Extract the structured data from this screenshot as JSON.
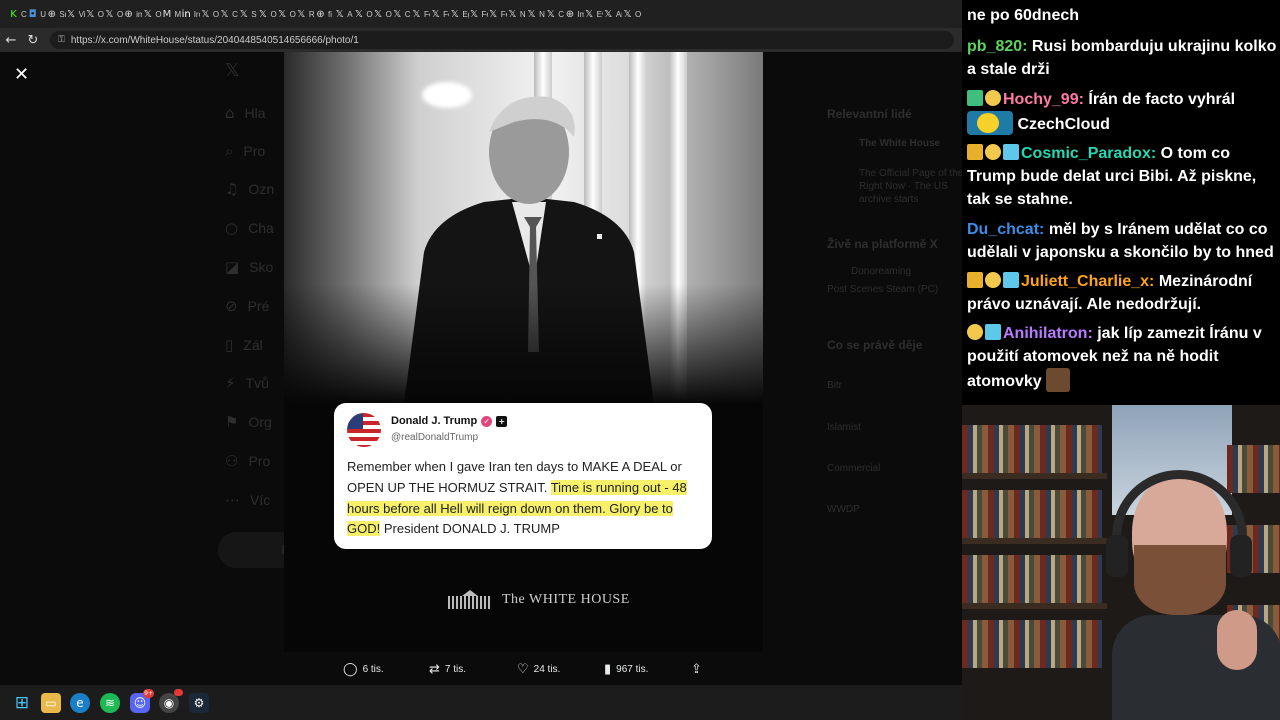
{
  "browser": {
    "tabs": [
      {
        "icon": "K",
        "title": "Cz",
        "color": "#53fc18"
      },
      {
        "icon": "◘",
        "title": "Us",
        "color": "#4a90d9"
      },
      {
        "icon": "⊕",
        "title": "Sn",
        "color": "#ddd"
      },
      {
        "icon": "𝕏",
        "title": "Vi",
        "color": "#ddd"
      },
      {
        "icon": "𝕏",
        "title": "O:",
        "color": "#ddd"
      },
      {
        "icon": "𝕏",
        "title": "O",
        "color": "#ddd"
      },
      {
        "icon": "⊕",
        "title": "im",
        "color": "#ddd"
      },
      {
        "icon": "𝕏",
        "title": "O:",
        "color": "#ddd"
      },
      {
        "icon": "M",
        "title": "M",
        "color": "#ddd"
      },
      {
        "icon": "in",
        "title": "Irc",
        "color": "#fff"
      },
      {
        "icon": "𝕏",
        "title": "O:",
        "color": "#ddd"
      },
      {
        "icon": "𝕏",
        "title": "Cl",
        "color": "#ddd"
      },
      {
        "icon": "𝕏",
        "title": "St",
        "color": "#ddd"
      },
      {
        "icon": "𝕏",
        "title": "O:",
        "color": "#ddd"
      },
      {
        "icon": "𝕏",
        "title": "O:",
        "color": "#ddd"
      },
      {
        "icon": "𝕏",
        "title": "Re",
        "color": "#ddd"
      },
      {
        "icon": "⊕",
        "title": "fi",
        "color": "#ddd"
      },
      {
        "icon": "𝕏",
        "title": "Al",
        "color": "#ddd"
      },
      {
        "icon": "𝕏",
        "title": "O:",
        "color": "#ddd"
      },
      {
        "icon": "𝕏",
        "title": "O:",
        "color": "#ddd"
      },
      {
        "icon": "𝕏",
        "title": "Cl",
        "color": "#ddd"
      },
      {
        "icon": "𝕏",
        "title": "Fe",
        "color": "#ddd"
      },
      {
        "icon": "𝕏",
        "title": "Fe",
        "color": "#ddd"
      },
      {
        "icon": "𝕏",
        "title": "Eg",
        "color": "#ddd"
      },
      {
        "icon": "𝕏",
        "title": "Fe",
        "color": "#ddd"
      },
      {
        "icon": "𝕏",
        "title": "Fe",
        "color": "#ddd"
      },
      {
        "icon": "𝕏",
        "title": "N",
        "color": "#ddd"
      },
      {
        "icon": "𝕏",
        "title": "N",
        "color": "#ddd"
      },
      {
        "icon": "𝕏",
        "title": "Cl",
        "color": "#ddd"
      },
      {
        "icon": "⊕",
        "title": "Im",
        "color": "#ddd"
      },
      {
        "icon": "𝕏",
        "title": "Ev",
        "color": "#ddd"
      },
      {
        "icon": "𝕏",
        "title": "Ar",
        "color": "#ddd"
      },
      {
        "icon": "𝕏",
        "title": "O",
        "color": "#ddd"
      }
    ],
    "url": "https://x.com/WhiteHouse/status/2040448540514656666/photo/1"
  },
  "bg_nav": [
    "Hla",
    "Pro",
    "Ozn",
    "Cha",
    "Sko",
    "Pré",
    "Zál",
    "Tvů",
    "Org",
    "Pro",
    "Víc"
  ],
  "bg_post_button": "P",
  "bg_right": {
    "rel_heading": "Relevantní lidé",
    "rel_name": "The White House",
    "rel_bio_1": "The Official Page of the",
    "rel_bio_2": "Right Now · The US",
    "rel_bio_3": "archive starts",
    "live_heading": "Živě na platformě X",
    "live_user": "Donoreaming",
    "live_title": "Post Scenes Steam (PC)",
    "trends_heading": "Co se právě děje",
    "trend_1": "Bitr",
    "trend_2": "Islamist",
    "trend_3": "Commercial",
    "trend_4": "WWDP"
  },
  "viewer": {
    "close_icon": "✕",
    "tweet": {
      "name": "Donald J. Trump",
      "handle": "@realDonaldTrump",
      "text_plain": "Remember when I gave Iran ten days to MAKE A DEAL or OPEN UP THE HORMUZ STRAIT. ",
      "text_highlight": "Time is running out - 48 hours before all Hell will reign down on them. Glory be to GOD!",
      "text_end": " President DONALD J. TRUMP",
      "highlight_color": "#f7f06a"
    },
    "logo_text": "The WHITE HOUSE",
    "actions": {
      "replies": "6 tis.",
      "reposts": "7 tis.",
      "likes": "24 tis.",
      "views": "967 tis."
    }
  },
  "taskbar": {
    "discord_badge": "9+"
  },
  "chat": {
    "messages": [
      {
        "user": "",
        "text": "ne po 60dnech",
        "color": "#ffffff"
      },
      {
        "user": "pb_820:",
        "text": "Rusi bombarduju ukrajinu kolko a stale drži",
        "color": "#5fd35f"
      },
      {
        "user": "Hochy_99:",
        "text": "Írán de facto vyhrál",
        "emote_label": "CzechCloud",
        "color": "#ff7aa8"
      },
      {
        "user": "Cosmic_Paradox:",
        "text": "O tom co Trump bude delat urci Bibi. Až piskne, tak se stahne.",
        "color": "#27d7b2"
      },
      {
        "user": "Du_chcat:",
        "text": "měl by s Iránem udělat co co udělali v japonsku a skončilo by to hned",
        "color": "#3c8ce7"
      },
      {
        "user": "Juliett_Charlie_x:",
        "text": "Mezinárodní právo uznávají. Ale nedodržují.",
        "color": "#ffa31a"
      },
      {
        "user": "Anihilatron:",
        "text": "jak líp zamezit Íránu v použití atomovek než na ně hodit atomovky",
        "color": "#b77cff"
      }
    ]
  }
}
